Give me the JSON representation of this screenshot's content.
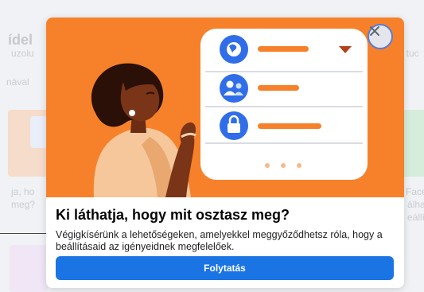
{
  "background": {
    "title_fragment": "ídel",
    "sub_fragment_1": "uzolu",
    "sub_fragment_2": "nával",
    "right_fragment": "t tuc",
    "caption_left_1": "ja, ho",
    "caption_left_2": "meg?",
    "caption_right_1": "Face",
    "caption_right_2": "álha",
    "caption_right_3": "eállít"
  },
  "modal": {
    "title": "Ki láthatja, hogy mit osztasz meg?",
    "description": "Végigkísérünk a lehetőségeken, amelyekkel meggyőződhetsz róla, hogy a beállításaid az igényeidnek megfelelőek.",
    "continue_label": "Folytatás"
  },
  "illustration": {
    "rows": [
      {
        "icon": "globe-icon",
        "has_dropdown": true
      },
      {
        "icon": "friends-icon",
        "has_dropdown": false
      },
      {
        "icon": "lock-icon",
        "has_dropdown": false
      }
    ]
  },
  "colors": {
    "hero_bg": "#f7812a",
    "primary_button": "#1b74e4",
    "accent_blue": "#2f6ee8"
  }
}
